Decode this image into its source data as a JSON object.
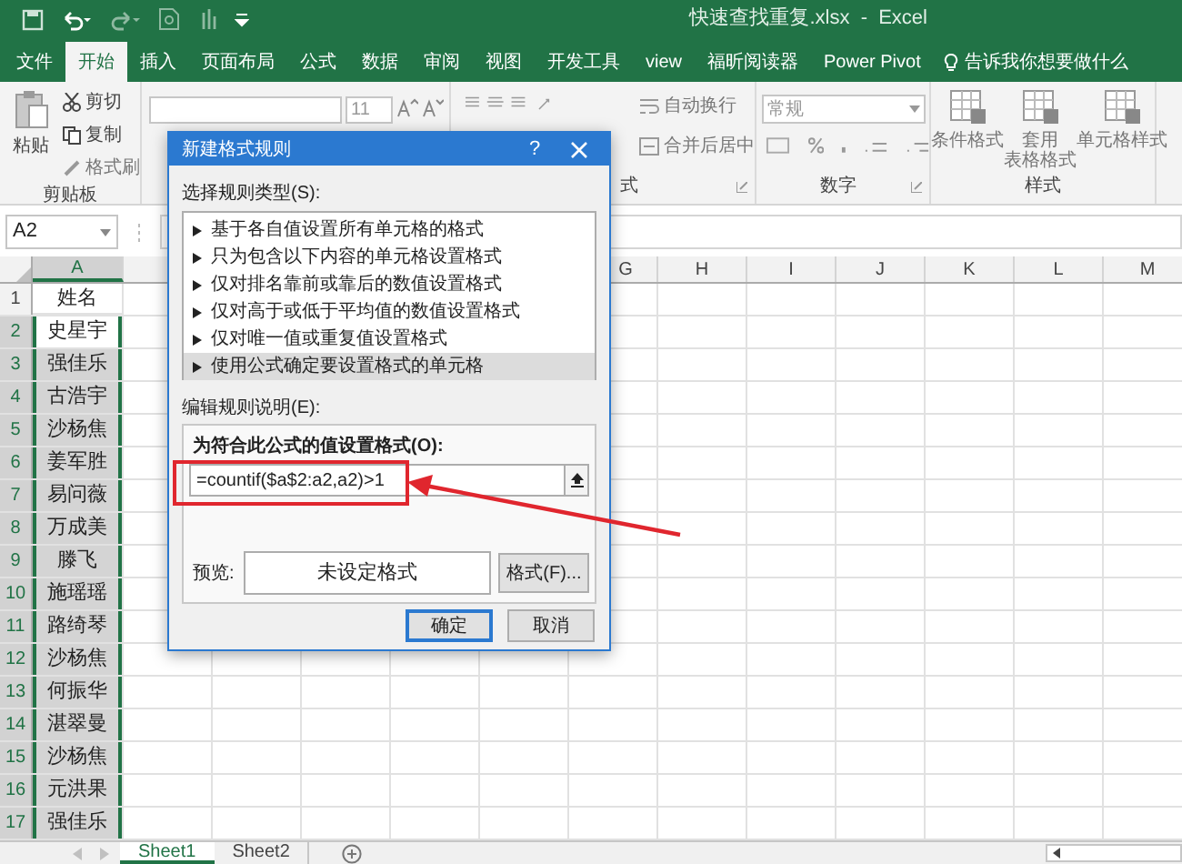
{
  "title_bar": {
    "title": "快速查找重复.xlsx  -  Excel"
  },
  "ribbon_tabs": [
    {
      "label": "文件",
      "selected": false
    },
    {
      "label": "开始",
      "selected": true
    },
    {
      "label": "插入",
      "selected": false
    },
    {
      "label": "页面布局",
      "selected": false
    },
    {
      "label": "公式",
      "selected": false
    },
    {
      "label": "数据",
      "selected": false
    },
    {
      "label": "审阅",
      "selected": false
    },
    {
      "label": "视图",
      "selected": false
    },
    {
      "label": "开发工具",
      "selected": false
    },
    {
      "label": "view",
      "selected": false
    },
    {
      "label": "福昕阅读器",
      "selected": false
    },
    {
      "label": "Power Pivot",
      "selected": false
    }
  ],
  "tell_me": {
    "placeholder": "告诉我你想要做什么"
  },
  "ribbon": {
    "clipboard": {
      "paste": "粘贴",
      "cut": "剪切",
      "copy": "复制",
      "format_painter": "格式刷",
      "label": "剪贴板"
    },
    "font": {
      "size": "11"
    },
    "alignment": {
      "wrap": "自动换行",
      "merge": "合并后居中",
      "label": "式"
    },
    "number": {
      "format": "常规",
      "label": "数字"
    },
    "styles": {
      "buttons": [
        {
          "lines": [
            "条件格式"
          ]
        },
        {
          "lines": [
            "套用",
            "表格格式"
          ]
        },
        {
          "lines": [
            "单元格样式"
          ]
        }
      ],
      "label": "样式"
    }
  },
  "name_box": "A2",
  "sheet": {
    "columns": [
      {
        "letter": "A",
        "selected": true
      },
      {
        "letter": "G",
        "selected": false
      },
      {
        "letter": "H",
        "selected": false
      },
      {
        "letter": "I",
        "selected": false
      },
      {
        "letter": "J",
        "selected": false
      },
      {
        "letter": "K",
        "selected": false
      },
      {
        "letter": "L",
        "selected": false
      },
      {
        "letter": "M",
        "selected": false
      }
    ],
    "rows": [
      {
        "number": "1",
        "value": "姓名",
        "selected": false
      },
      {
        "number": "2",
        "value": "史星宇",
        "selected": true,
        "active": true
      },
      {
        "number": "3",
        "value": "强佳乐",
        "selected": true
      },
      {
        "number": "4",
        "value": "古浩宇",
        "selected": true
      },
      {
        "number": "5",
        "value": "沙杨焦",
        "selected": true
      },
      {
        "number": "6",
        "value": "姜军胜",
        "selected": true
      },
      {
        "number": "7",
        "value": "易问薇",
        "selected": true
      },
      {
        "number": "8",
        "value": "万成美",
        "selected": true
      },
      {
        "number": "9",
        "value": "滕飞",
        "selected": true
      },
      {
        "number": "10",
        "value": "施瑶瑶",
        "selected": true
      },
      {
        "number": "11",
        "value": "路绮琴",
        "selected": true
      },
      {
        "number": "12",
        "value": "沙杨焦",
        "selected": true
      },
      {
        "number": "13",
        "value": "何振华",
        "selected": true
      },
      {
        "number": "14",
        "value": "湛翠曼",
        "selected": true
      },
      {
        "number": "15",
        "value": "沙杨焦",
        "selected": true
      },
      {
        "number": "16",
        "value": "元洪果",
        "selected": true
      },
      {
        "number": "17",
        "value": "强佳乐",
        "selected": true
      }
    ]
  },
  "sheet_tabs": [
    {
      "label": "Sheet1",
      "selected": true
    },
    {
      "label": "Sheet2",
      "selected": false
    }
  ],
  "dialog": {
    "title": "新建格式规则",
    "help": "?",
    "rule_type_label": "选择规则类型(S):",
    "rule_types": [
      {
        "label": "基于各自值设置所有单元格的格式",
        "selected": false
      },
      {
        "label": "只为包含以下内容的单元格设置格式",
        "selected": false
      },
      {
        "label": "仅对排名靠前或靠后的数值设置格式",
        "selected": false
      },
      {
        "label": "仅对高于或低于平均值的数值设置格式",
        "selected": false
      },
      {
        "label": "仅对唯一值或重复值设置格式",
        "selected": false
      },
      {
        "label": "使用公式确定要设置格式的单元格",
        "selected": true
      }
    ],
    "description_label": "编辑规则说明(E):",
    "formula_label": "为符合此公式的值设置格式(O):",
    "formula": "=countif($a$2:a2,a2)>1",
    "preview_label": "预览:",
    "preview_text": "未设定格式",
    "format_button": "格式(F)...",
    "buttons": [
      {
        "label": "确定",
        "default": true
      },
      {
        "label": "取消",
        "default": false
      }
    ]
  }
}
